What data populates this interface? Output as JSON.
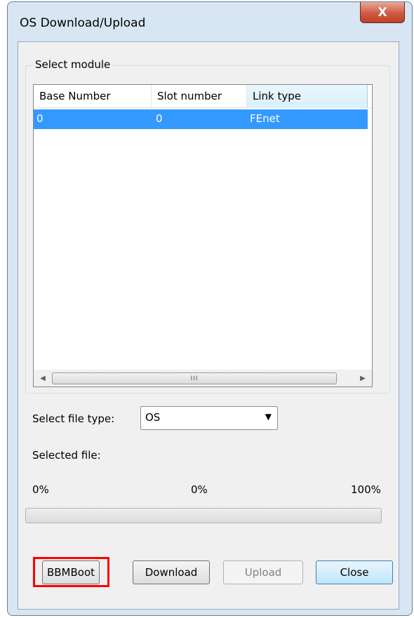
{
  "window": {
    "title": "OS Download/Upload",
    "close_glyph": "X"
  },
  "module_group": {
    "label": "Select module",
    "columns": [
      "Base Number",
      "Slot number",
      "Link type"
    ],
    "rows": [
      {
        "base": "0",
        "slot": "0",
        "link": "FEnet",
        "selected": true
      }
    ],
    "scroll_grip": "III"
  },
  "file_type": {
    "label": "Select file type:",
    "value": "OS",
    "arrow": "▼"
  },
  "selected_file": {
    "label": "Selected file:"
  },
  "progress": {
    "left_label": "0%",
    "mid_label": "0%",
    "right_label": "100%",
    "value": 0
  },
  "buttons": {
    "bbmboot": "BBMBoot",
    "download": "Download",
    "upload": "Upload",
    "close": "Close"
  },
  "colors": {
    "selection": "#3399ff",
    "highlight_box": "#ff0000"
  }
}
